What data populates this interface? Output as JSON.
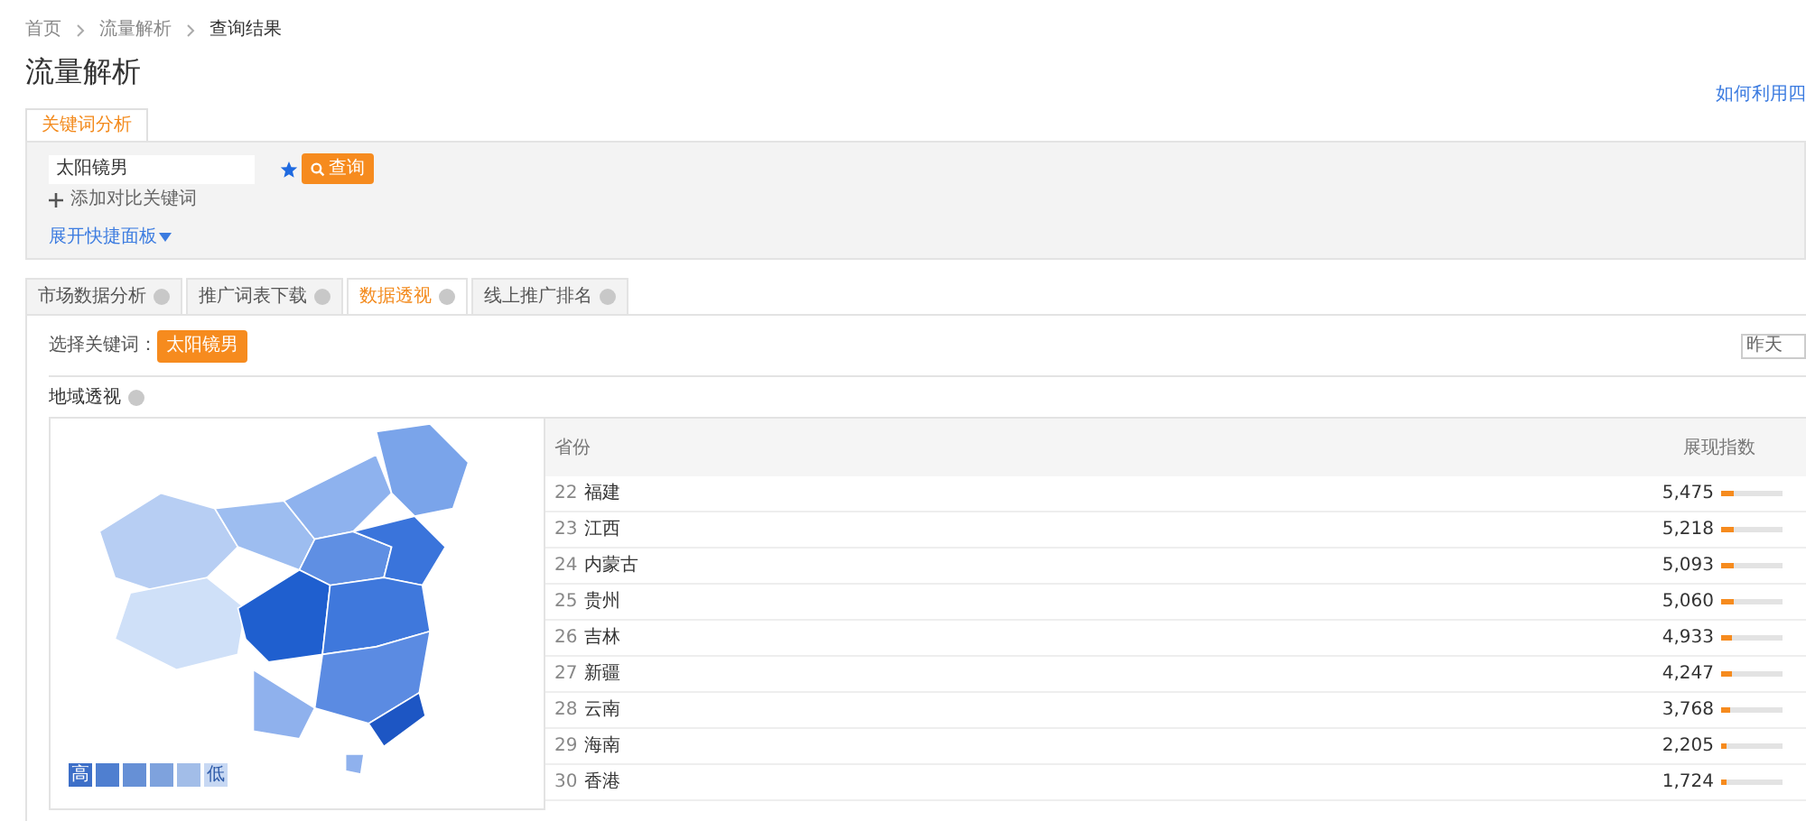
{
  "breadcrumb": [
    "首页",
    "流量解析",
    "查询结果"
  ],
  "page_title": "流量解析",
  "help_link": "如何利用四",
  "keyword_tab": {
    "label": "关键词分析",
    "selected": true
  },
  "search": {
    "value": "太阳镜男",
    "starred": true,
    "button": "查询",
    "add_compare": "添加对比关键词",
    "expand_panel": "展开快捷面板"
  },
  "tabs": [
    {
      "label": "市场数据分析",
      "selected": false
    },
    {
      "label": "推广词表下载",
      "selected": false
    },
    {
      "label": "数据透视",
      "selected": true
    },
    {
      "label": "线上推广排名",
      "selected": false
    }
  ],
  "keyword_select": {
    "label": "选择关键词：",
    "chip": "太阳镜男"
  },
  "date_select": {
    "value": "昨天"
  },
  "region_title": "地域透视",
  "legend": {
    "high": "高",
    "low": "低"
  },
  "table": {
    "columns": [
      "省份",
      "展现指数"
    ],
    "rows": [
      {
        "rank": "22",
        "province": "福建",
        "value": "5,475",
        "level": 0.22
      },
      {
        "rank": "23",
        "province": "江西",
        "value": "5,218",
        "level": 0.21
      },
      {
        "rank": "24",
        "province": "内蒙古",
        "value": "5,093",
        "level": 0.2
      },
      {
        "rank": "25",
        "province": "贵州",
        "value": "5,060",
        "level": 0.2
      },
      {
        "rank": "26",
        "province": "吉林",
        "value": "4,933",
        "level": 0.19
      },
      {
        "rank": "27",
        "province": "新疆",
        "value": "4,247",
        "level": 0.17
      },
      {
        "rank": "28",
        "province": "云南",
        "value": "3,768",
        "level": 0.15
      },
      {
        "rank": "29",
        "province": "海南",
        "value": "2,205",
        "level": 0.1
      },
      {
        "rank": "30",
        "province": "香港",
        "value": "1,724",
        "level": 0.08
      }
    ]
  }
}
